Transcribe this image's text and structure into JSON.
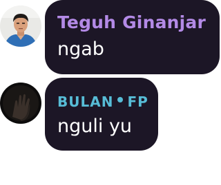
{
  "messages": [
    {
      "sender": "Teguh Ginanjar",
      "text": "ngab",
      "sender_color": "#b38ae6",
      "avatar_icon": "person-photo-avatar"
    },
    {
      "sender_parts": [
        "BULAN",
        "FP"
      ],
      "text": "nguli yu",
      "sender_color": "#57bcd6",
      "avatar_icon": "dark-hand-photo-avatar"
    }
  ],
  "colors": {
    "bubble_background": "#1c1626",
    "page_background": "#ffffff",
    "message_text": "#ffffff"
  }
}
